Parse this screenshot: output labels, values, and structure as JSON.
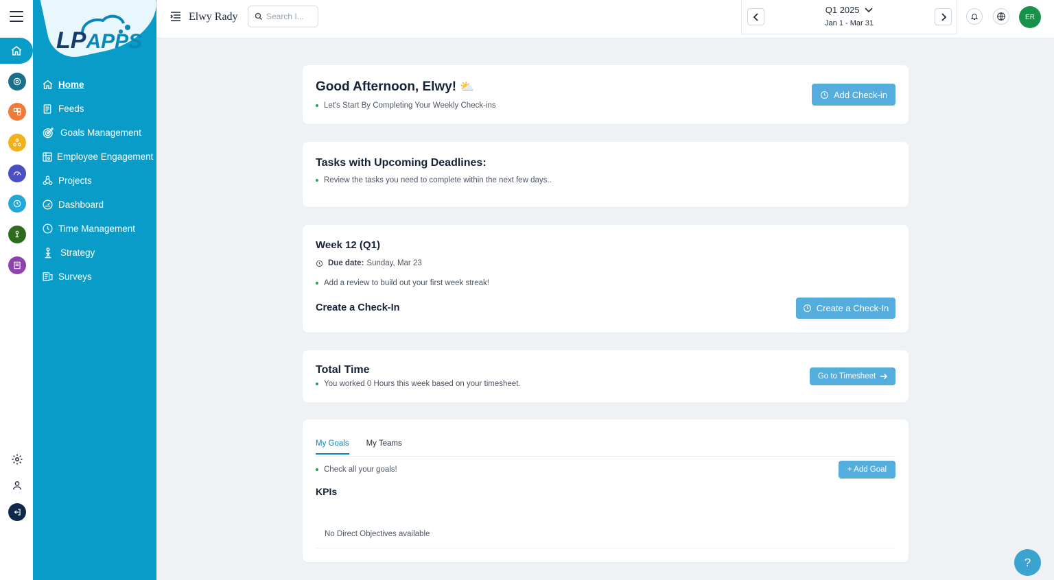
{
  "app": {
    "logo_text": "APPS",
    "logo_prefix": "LP"
  },
  "sidebar": {
    "items": [
      {
        "label": "Home",
        "icon": "home-icon",
        "active": true
      },
      {
        "label": "Feeds",
        "icon": "feed-icon"
      },
      {
        "label": "Goals Management",
        "icon": "target-icon"
      },
      {
        "label": "Employee Engagement",
        "icon": "engagement-icon"
      },
      {
        "label": "Projects",
        "icon": "projects-icon"
      },
      {
        "label": "Dashboard",
        "icon": "dashboard-icon"
      },
      {
        "label": "Time Management",
        "icon": "clock-icon"
      },
      {
        "label": "Strategy",
        "icon": "strategy-icon"
      },
      {
        "label": "Surveys",
        "icon": "survey-icon"
      }
    ]
  },
  "rail": {
    "colors": [
      "#1a6f8a",
      "#f07a3a",
      "#f2b21b",
      "#4a4fc4",
      "#22a7d8",
      "#2f6b1c",
      "#8e44ad"
    ]
  },
  "topbar": {
    "user_name": "Elwy Rady",
    "search_placeholder": "Search I...",
    "quarter": "Q1 2025",
    "quarter_range": "Jan 1 - Mar 31",
    "avatar_initials": "ER"
  },
  "greeting": {
    "title": "Good Afternoon, Elwy!",
    "emoji": "⛅",
    "subtitle": "Let's Start By Completing Your Weekly Check-ins",
    "button": "Add Check-in"
  },
  "deadlines": {
    "title": "Tasks with Upcoming Deadlines:",
    "subtitle": "Review the tasks you need to complete within the next few days.."
  },
  "week": {
    "title": "Week 12 (Q1)",
    "due_label": "Due date:",
    "due_value": "Sunday, Mar 23",
    "subtitle": "Add a review to build out your first week streak!",
    "create_title": "Create a Check-In",
    "button": "Create a Check-In"
  },
  "total_time": {
    "title": "Total Time",
    "subtitle": "You worked 0 Hours this week based on your timesheet.",
    "button": "Go to Timesheet"
  },
  "goals": {
    "tabs": [
      "My Goals",
      "My Teams"
    ],
    "subtitle": "Check all your goals!",
    "button": "+ Add Goal",
    "section_title": "KPIs",
    "empty": "No Direct Objectives available"
  },
  "colors": {
    "sidebar": "#0a9cc9",
    "button": "#55addd",
    "avatar": "#17924a",
    "bullet": "#22a35a"
  },
  "help": "?"
}
